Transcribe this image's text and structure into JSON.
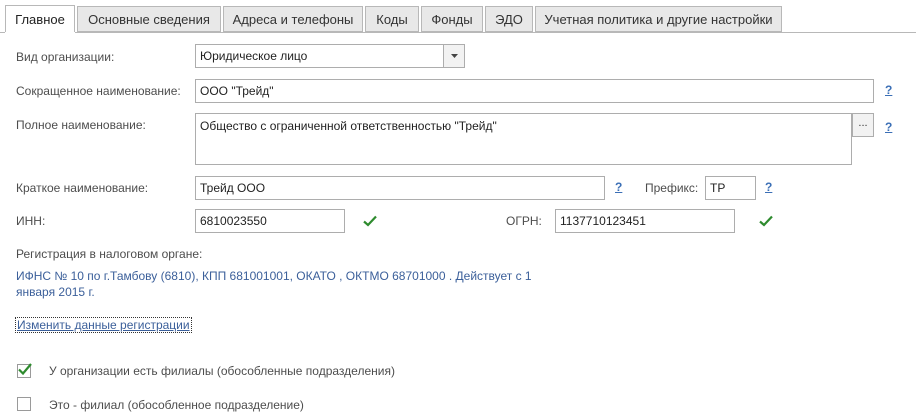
{
  "tabs": [
    {
      "label": "Главное"
    },
    {
      "label": "Основные сведения"
    },
    {
      "label": "Адреса и телефоны"
    },
    {
      "label": "Коды"
    },
    {
      "label": "Фонды"
    },
    {
      "label": "ЭДО"
    },
    {
      "label": "Учетная политика и другие настройки"
    }
  ],
  "org_type": {
    "label": "Вид организации:",
    "value": "Юридическое лицо"
  },
  "short_name": {
    "label": "Сокращенное наименование:",
    "value": "ООО \"Трейд\"",
    "help": "?"
  },
  "full_name": {
    "label": "Полное наименование:",
    "value": "Общество с ограниченной ответственностью \"Трейд\"",
    "button": "...",
    "help": "?"
  },
  "brief_name": {
    "label": "Краткое наименование:",
    "value": "Трейд ООО",
    "help": "?"
  },
  "prefix": {
    "label": "Префикс:",
    "value": "ТР",
    "help": "?"
  },
  "inn": {
    "label": "ИНН:",
    "value": "6810023550"
  },
  "ogrn": {
    "label": "ОГРН:",
    "value": "1137710123451"
  },
  "registration": {
    "label": "Регистрация в налоговом органе:",
    "line1": "ИФНС № 10 по г.Тамбову (6810), КПП 681001001, ОКАТО , ОКТМО 68701000   . Действует с 1",
    "line2": "января 2015 г.",
    "change_link": "Изменить данные регистрации"
  },
  "has_branches": {
    "label": "У организации есть филиалы (обособленные подразделения)",
    "checked": true
  },
  "is_branch": {
    "label": "Это - филиал (обособленное подразделение)",
    "checked": false
  },
  "colors": {
    "accent_check": "#2e8b2e",
    "link": "#3b5f9a"
  }
}
